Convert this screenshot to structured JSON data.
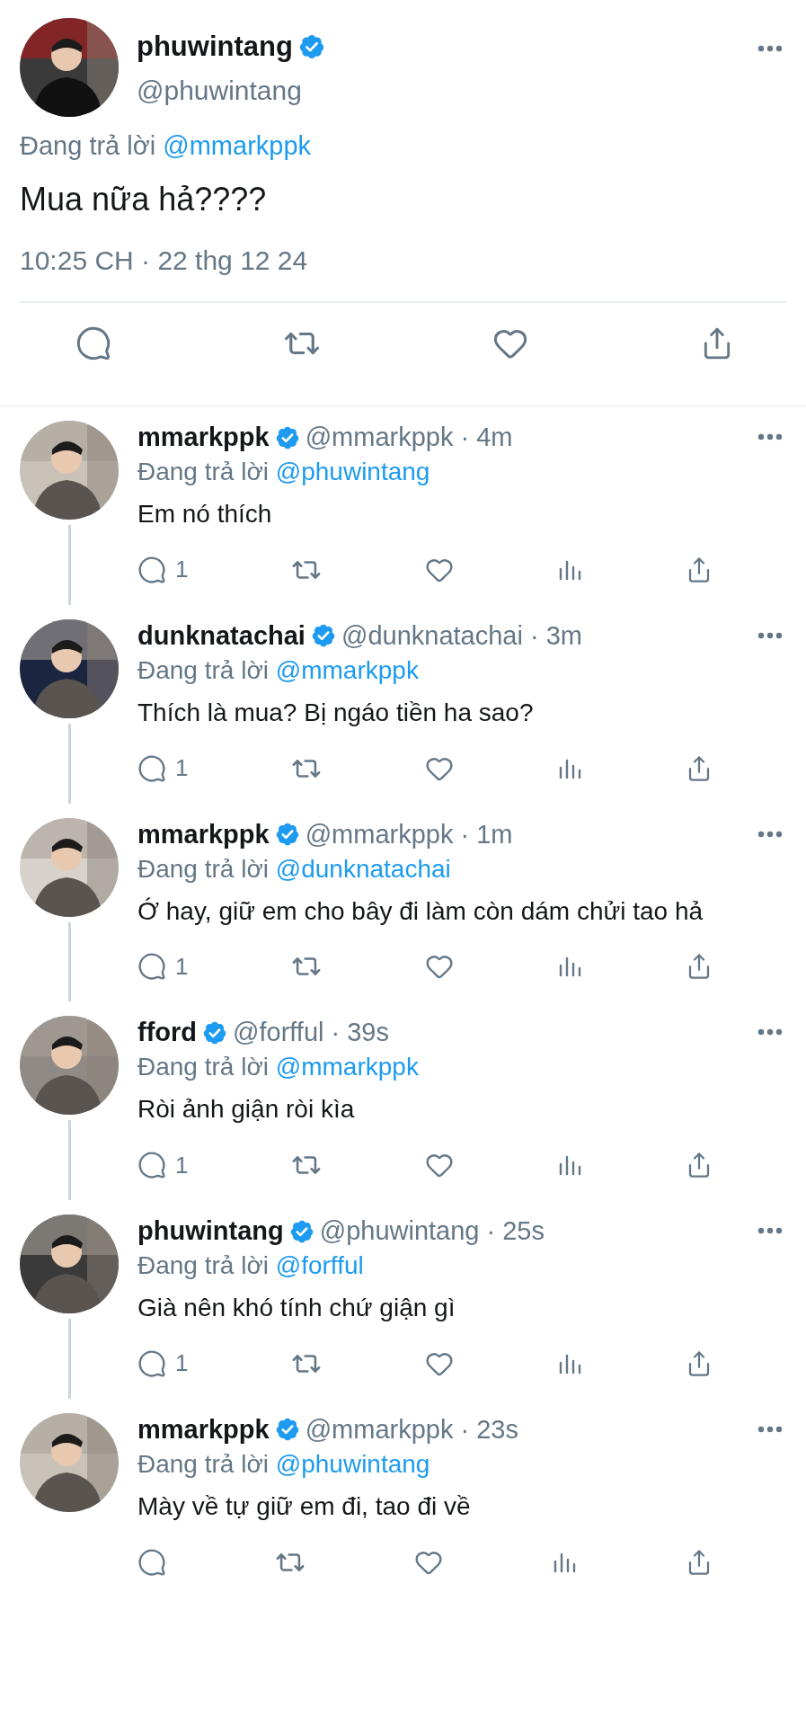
{
  "main_tweet": {
    "display_name": "phuwintang",
    "verified": true,
    "handle": "@phuwintang",
    "reply_label": "Đang trả lời",
    "reply_to": "@mmarkppk",
    "text": "Mua nữa hả????",
    "timestamp": "10:25 CH · 22 thg 12 24"
  },
  "replies": [
    {
      "display_name": "mmarkppk",
      "verified": true,
      "meta": "@mmarkppk · 4m",
      "reply_label": "Đang trả lời",
      "reply_to": "@phuwintang",
      "text": "Em nó thích",
      "reply_count": "1"
    },
    {
      "display_name": "dunknatachai",
      "verified": true,
      "meta": "@dunknatachai · 3m",
      "reply_label": "Đang trả lời",
      "reply_to": "@mmarkppk",
      "text": "Thích là mua? Bị ngáo tiền ha sao?",
      "reply_count": "1"
    },
    {
      "display_name": "mmarkppk",
      "verified": true,
      "meta": "@mmarkppk · 1m",
      "reply_label": "Đang trả lời",
      "reply_to": "@dunknatachai",
      "text": "Ớ hay, giữ em cho bây đi làm còn dám chửi tao hả",
      "reply_count": "1"
    },
    {
      "display_name": "fford",
      "verified": true,
      "meta": "@forfful · 39s",
      "reply_label": "Đang trả lời",
      "reply_to": "@mmarkppk",
      "text": "Ròi ảnh giận ròi kìa",
      "reply_count": "1"
    },
    {
      "display_name": "phuwintang",
      "verified": true,
      "meta": "@phuwintang · 25s",
      "reply_label": "Đang trả lời",
      "reply_to": "@forfful",
      "text": "Già nên khó tính chứ giận gì",
      "reply_count": "1"
    },
    {
      "display_name": "mmarkppk",
      "verified": true,
      "meta": "@mmarkppk · 23s",
      "reply_label": "Đang trả lời",
      "reply_to": "@phuwintang",
      "text": "Mày về tự giữ em đi, tao đi về"
    }
  ]
}
